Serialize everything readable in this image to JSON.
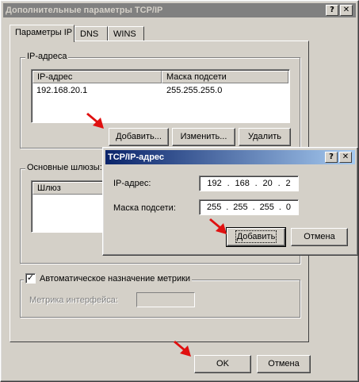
{
  "main_window": {
    "title": "Дополнительные параметры TCP/IP",
    "help_label": "?",
    "close_label": "✕",
    "tabs": [
      {
        "label": "Параметры IP"
      },
      {
        "label": "DNS"
      },
      {
        "label": "WINS"
      }
    ],
    "ip_group": {
      "title": "IP-адреса",
      "columns": [
        "IP-адрес",
        "Маска подсети"
      ],
      "rows": [
        [
          "192.168.20.1",
          "255.255.255.0"
        ]
      ],
      "add_label": "Добавить...",
      "edit_label": "Изменить...",
      "delete_label": "Удалить"
    },
    "gateway_group": {
      "title": "Основные шлюзы:",
      "columns": [
        "Шлюз"
      ]
    },
    "auto_metric": {
      "checked": true,
      "label": "Автоматическое назначение метрики",
      "interface_metric_label": "Метрика интерфейса:"
    },
    "ok_label": "OK",
    "cancel_label": "Отмена"
  },
  "dialog": {
    "title": "TCP/IP-адрес",
    "help_label": "?",
    "close_label": "✕",
    "ip_label": "IP-адрес:",
    "ip_octets": [
      "192",
      "168",
      "20",
      "2"
    ],
    "mask_label": "Маска подсети:",
    "mask_octets": [
      "255",
      "255",
      "255",
      "0"
    ],
    "dot": ".",
    "add_label": "Добавить",
    "cancel_label": "Отмена"
  },
  "colors": {
    "dialog_face": "#d4d0c8",
    "active_title": "#0a246a",
    "inactive_title": "#808080",
    "annotation_arrow": "#e01010"
  },
  "icons": [
    "help-icon",
    "close-icon",
    "checkmark-icon",
    "red-arrow-icon"
  ]
}
